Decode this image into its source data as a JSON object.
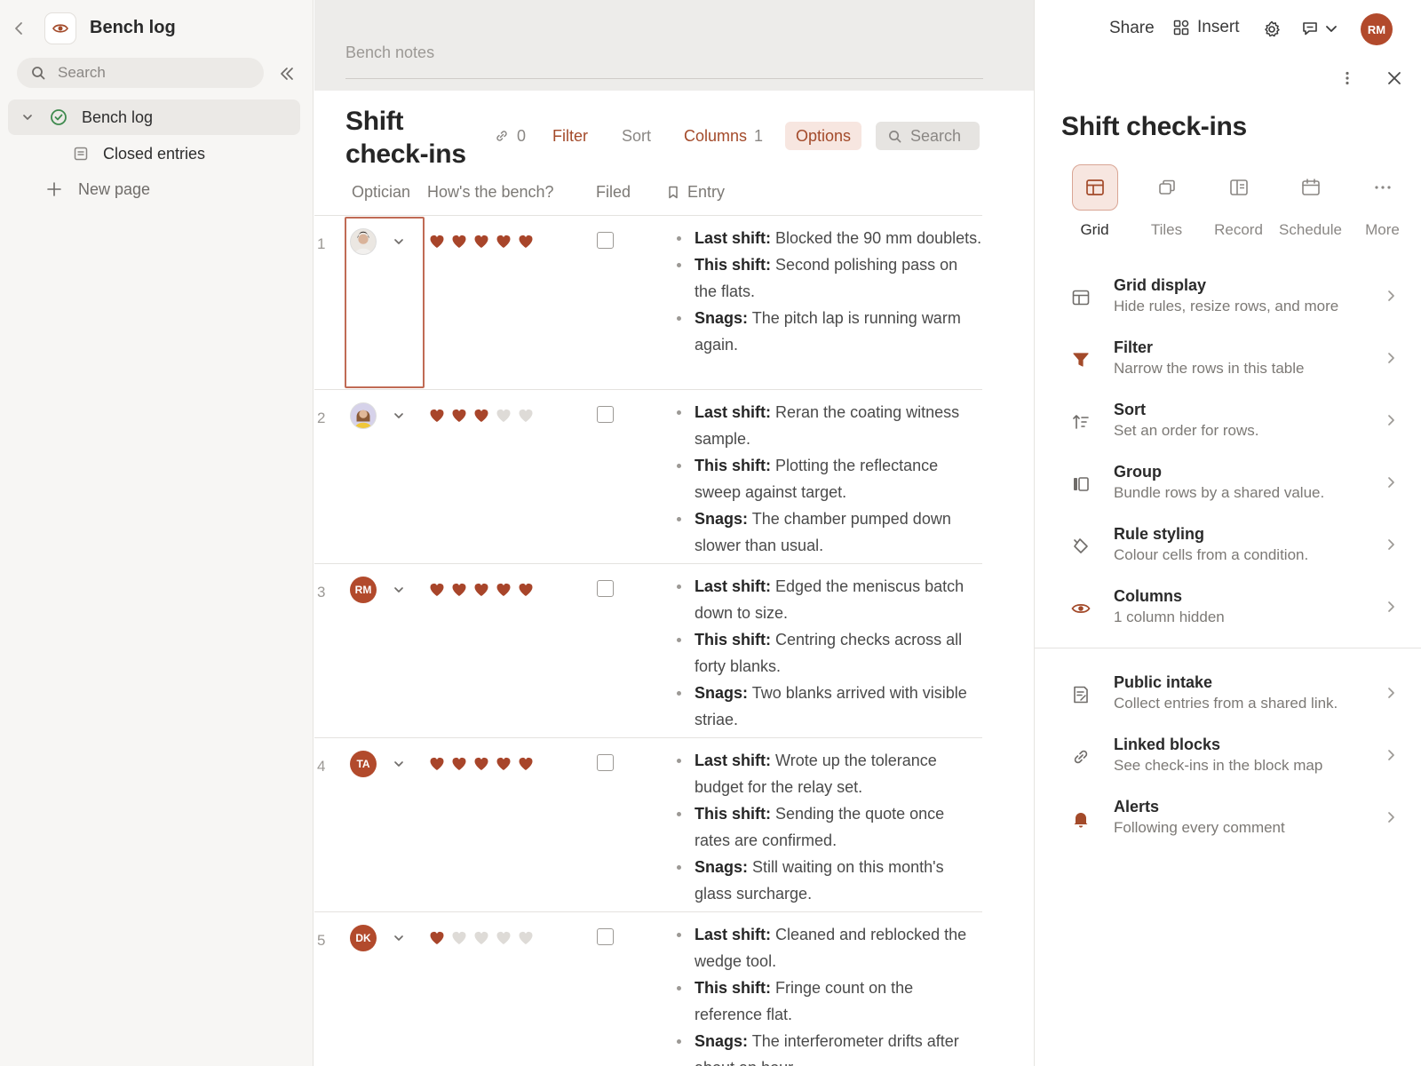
{
  "colors": {
    "accent": "#a34a2a",
    "heart_on": "#a8452a",
    "heart_off": "#dedbd7",
    "avatar_bg": "#b24a2c"
  },
  "sidebar": {
    "title": "Bench log",
    "search_placeholder": "Search",
    "items": [
      {
        "label": "Bench log",
        "icon": "check-circle-icon"
      },
      {
        "label": "Closed entries",
        "icon": "document-icon"
      }
    ],
    "new_page": "New page"
  },
  "main": {
    "breadcrumb_title": "Bench notes",
    "table_title": "Shift check-ins",
    "toolbar": {
      "link_count": "0",
      "filter": "Filter",
      "sort": "Sort",
      "columns": "Columns",
      "columns_count": "1",
      "options": "Options",
      "search": "Search"
    },
    "columns": [
      "Optician",
      "How's the bench?",
      "Filed",
      "Entry"
    ],
    "rows": [
      {
        "num": "1",
        "avatar": "photo-woman-1",
        "initials": "",
        "hearts": 5,
        "filed": false,
        "selected": true,
        "entry": [
          {
            "label": "Last shift:",
            "text": "Blocked the 90 mm doublets."
          },
          {
            "label": "This shift:",
            "text": "Second polishing pass on the flats."
          },
          {
            "label": "Snags:",
            "text": "The pitch lap is running warm again."
          }
        ]
      },
      {
        "num": "2",
        "avatar": "photo-woman-2",
        "initials": "",
        "hearts": 3,
        "filed": false,
        "selected": false,
        "entry": [
          {
            "label": "Last shift:",
            "text": "Reran the coating witness sample."
          },
          {
            "label": "This shift:",
            "text": "Plotting the reflectance sweep against target."
          },
          {
            "label": "Snags:",
            "text": "The chamber pumped down slower than usual."
          }
        ]
      },
      {
        "num": "3",
        "avatar": "initials",
        "initials": "RM",
        "hearts": 5,
        "filed": false,
        "selected": false,
        "entry": [
          {
            "label": "Last shift:",
            "text": "Edged the meniscus batch down to size."
          },
          {
            "label": "This shift:",
            "text": "Centring checks across all forty blanks."
          },
          {
            "label": "Snags:",
            "text": "Two blanks arrived with visible striae."
          }
        ]
      },
      {
        "num": "4",
        "avatar": "initials",
        "initials": "TA",
        "hearts": 5,
        "filed": false,
        "selected": false,
        "entry": [
          {
            "label": "Last shift:",
            "text": "Wrote up the tolerance budget for the relay set."
          },
          {
            "label": "This shift:",
            "text": "Sending the quote once rates are confirmed."
          },
          {
            "label": "Snags:",
            "text": "Still waiting on this month's glass surcharge."
          }
        ]
      },
      {
        "num": "5",
        "avatar": "initials",
        "initials": "DK",
        "hearts": 1,
        "filed": false,
        "selected": false,
        "entry": [
          {
            "label": "Last shift:",
            "text": "Cleaned and reblocked the wedge tool."
          },
          {
            "label": "This shift:",
            "text": "Fringe count on the reference flat."
          },
          {
            "label": "Snags:",
            "text": "The interferometer drifts after about an hour."
          }
        ]
      }
    ]
  },
  "panel": {
    "share": "Share",
    "insert": "Insert",
    "user_initials": "RM",
    "title": "Shift check-ins",
    "views": [
      {
        "label": "Grid",
        "icon": "grid-view-icon",
        "active": true
      },
      {
        "label": "Tiles",
        "icon": "tiles-view-icon",
        "active": false
      },
      {
        "label": "Record",
        "icon": "record-view-icon",
        "active": false
      },
      {
        "label": "Schedule",
        "icon": "calendar-icon",
        "active": false
      },
      {
        "label": "More",
        "icon": "more-horizontal-icon",
        "active": false
      }
    ],
    "options": [
      {
        "title": "Grid display",
        "subtitle": "Hide rules, resize rows, and more",
        "icon": "grid-layout-icon"
      },
      {
        "title": "Filter",
        "subtitle": "Narrow the rows in this table",
        "icon": "filter-icon"
      },
      {
        "title": "Sort",
        "subtitle": "Set an order for rows.",
        "icon": "sort-icon"
      },
      {
        "title": "Group",
        "subtitle": "Bundle rows by a shared value.",
        "icon": "group-icon"
      },
      {
        "title": "Rule styling",
        "subtitle": "Colour cells from a condition.",
        "icon": "paint-bucket-icon"
      },
      {
        "title": "Columns",
        "subtitle": "1 column hidden",
        "icon": "eye-icon"
      }
    ],
    "extras": [
      {
        "title": "Public intake",
        "subtitle": "Collect entries from a shared link.",
        "icon": "form-icon"
      },
      {
        "title": "Linked blocks",
        "subtitle": "See check-ins in the block map",
        "icon": "link-icon"
      },
      {
        "title": "Alerts",
        "subtitle": "Following every comment",
        "icon": "bell-icon"
      }
    ]
  }
}
